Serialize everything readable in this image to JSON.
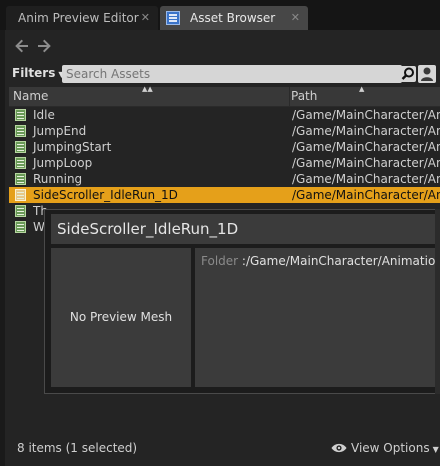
{
  "tabs": [
    {
      "label": "Anim Preview Editor",
      "close": "✕"
    },
    {
      "label": "Asset Browser",
      "close": "✕"
    }
  ],
  "nav": {
    "back_icon": "arrow-left-icon",
    "forward_icon": "arrow-right-icon"
  },
  "toolbar": {
    "filters_label": "Filters",
    "search_placeholder": "Search Assets"
  },
  "table": {
    "columns": {
      "name": "Name",
      "path": "Path"
    },
    "rows": [
      {
        "name": "Idle",
        "path": "/Game/MainCharacter/An"
      },
      {
        "name": "JumpEnd",
        "path": "/Game/MainCharacter/An"
      },
      {
        "name": "JumpingStart",
        "path": "/Game/MainCharacter/An"
      },
      {
        "name": "JumpLoop",
        "path": "/Game/MainCharacter/An"
      },
      {
        "name": "Running",
        "path": "/Game/MainCharacter/An"
      },
      {
        "name": "SideScroller_IdleRun_1D",
        "path": "/Game/MainCharacter/An",
        "selected": true
      },
      {
        "name": "Th",
        "path": ""
      },
      {
        "name": "W",
        "path": ""
      }
    ]
  },
  "tooltip": {
    "title": "SideScroller_IdleRun_1D",
    "preview_text": "No Preview Mesh",
    "folder_label": "Folder",
    "folder_value": ":/Game/MainCharacter/Animation"
  },
  "status": {
    "count_text": "8 items (1 selected)",
    "view_options": "View Options"
  },
  "colors": {
    "selection": "#e5a01a",
    "accent_blue": "#3a73c9",
    "asset_green": "#6a9a58"
  }
}
